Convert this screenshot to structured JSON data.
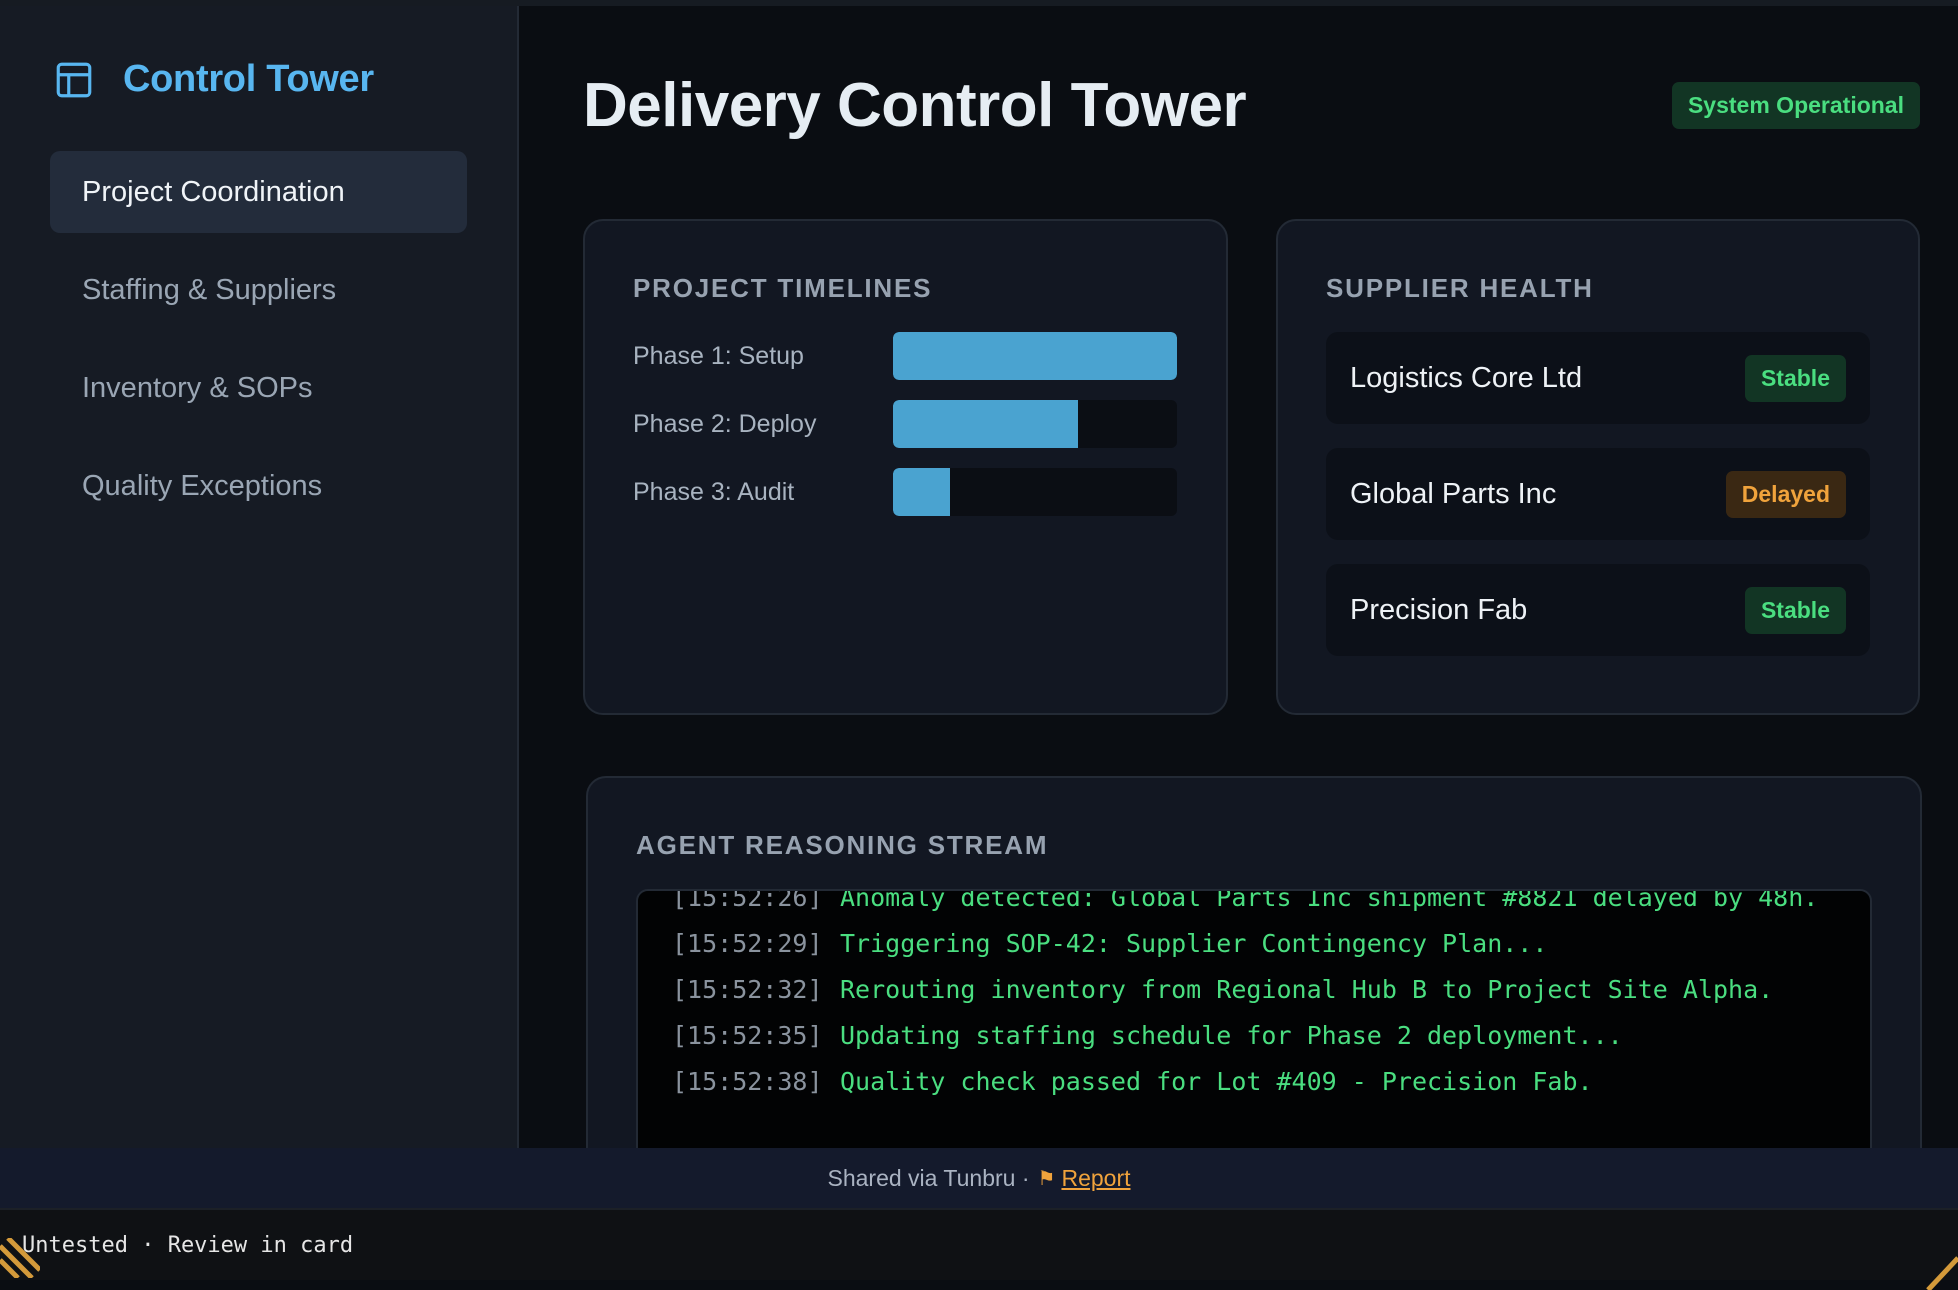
{
  "brand": {
    "title": "Control Tower",
    "icon": "layout-icon"
  },
  "sidebar": {
    "items": [
      {
        "label": "Project Coordination",
        "active": true
      },
      {
        "label": "Staffing & Suppliers",
        "active": false
      },
      {
        "label": "Inventory & SOPs",
        "active": false
      },
      {
        "label": "Quality Exceptions",
        "active": false
      }
    ]
  },
  "header": {
    "title": "Delivery Control Tower",
    "status": "System Operational"
  },
  "timelines": {
    "title": "PROJECT TIMELINES",
    "phases": [
      {
        "label": "Phase 1: Setup",
        "progress": 1.0
      },
      {
        "label": "Phase 2: Deploy",
        "progress": 0.65
      },
      {
        "label": "Phase 3: Audit",
        "progress": 0.2
      }
    ]
  },
  "suppliers": {
    "title": "SUPPLIER HEALTH",
    "items": [
      {
        "name": "Logistics Core Ltd",
        "status": "Stable"
      },
      {
        "name": "Global Parts Inc",
        "status": "Delayed"
      },
      {
        "name": "Precision Fab",
        "status": "Stable"
      }
    ]
  },
  "stream": {
    "title": "AGENT REASONING STREAM",
    "lines": [
      {
        "ts": "[15:52:26]",
        "msg": "Anomaly detected: Global Parts Inc shipment #8821 delayed by 48h."
      },
      {
        "ts": "[15:52:29]",
        "msg": "Triggering SOP-42: Supplier Contingency Plan..."
      },
      {
        "ts": "[15:52:32]",
        "msg": "Rerouting inventory from Regional Hub B to Project Site Alpha."
      },
      {
        "ts": "[15:52:35]",
        "msg": "Updating staffing schedule for Phase 2 deployment..."
      },
      {
        "ts": "[15:52:38]",
        "msg": "Quality check passed for Lot #409 - Precision Fab."
      }
    ]
  },
  "footer": {
    "shared": "Shared via Tunbru ·",
    "report": "Report"
  },
  "statusbar": {
    "text": "Untested · Review in card"
  },
  "colors": {
    "accent": "#58b6f0",
    "bar": "#4aa3d0",
    "stable": "#4ade80",
    "delayed": "#f0a33c"
  }
}
